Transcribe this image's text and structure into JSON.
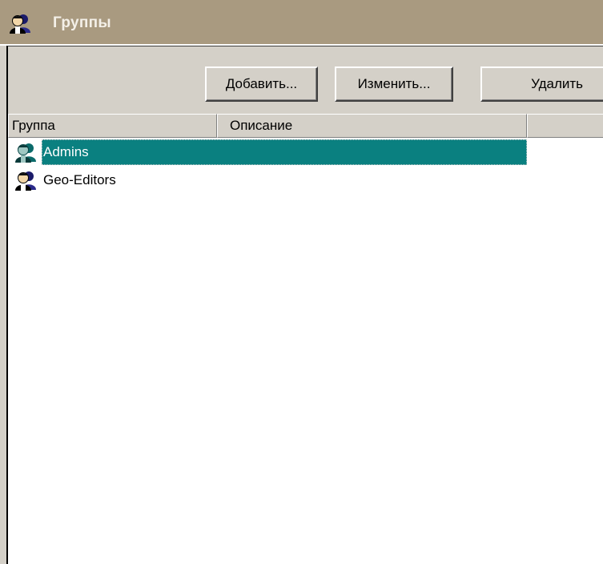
{
  "window": {
    "title": "Группы",
    "title_icon": "users-group-icon"
  },
  "toolbar": {
    "add_label": "Добавить...",
    "edit_label": "Изменить...",
    "delete_label": "Удалить"
  },
  "list": {
    "columns": [
      {
        "label": "Группа"
      },
      {
        "label": "Описание"
      },
      {
        "label": ""
      }
    ],
    "rows": [
      {
        "name": "Admins",
        "description": "",
        "icon": "users-group-icon",
        "selected": true
      },
      {
        "name": "Geo-Editors",
        "description": "",
        "icon": "users-group-icon",
        "selected": false
      }
    ]
  },
  "colors": {
    "titlebar": "#a99a80",
    "selection": "#0a8080",
    "face": "#d4d0c8"
  }
}
